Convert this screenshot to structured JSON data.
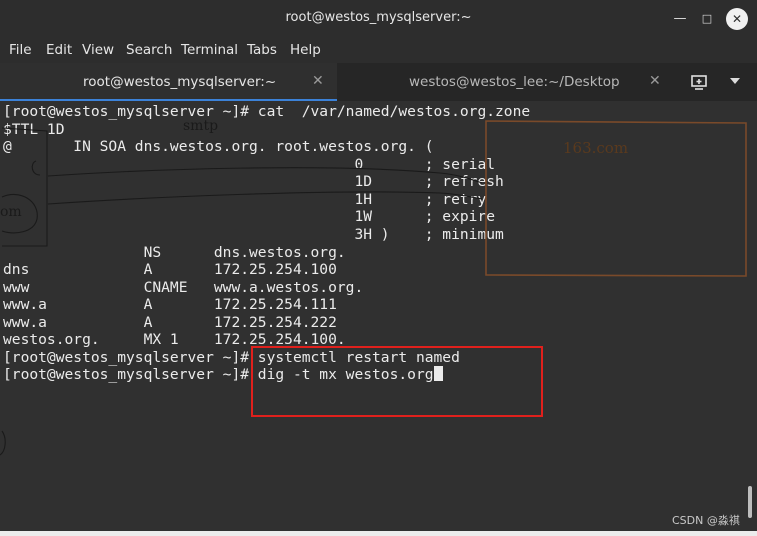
{
  "window": {
    "title": "root@westos_mysqlserver:~"
  },
  "menu": [
    "File",
    "Edit",
    "View",
    "Search",
    "Terminal",
    "Tabs",
    "Help"
  ],
  "tabs": [
    {
      "label": "root@westos_mysqlserver:~",
      "active": true
    },
    {
      "label": "westos@westos_lee:~/Desktop",
      "active": false
    }
  ],
  "terminal": {
    "lines": [
      "[root@westos_mysqlserver ~]# cat  /var/named/westos.org.zone",
      "$TTL 1D",
      "@       IN SOA dns.westos.org. root.westos.org. (",
      "                                        0       ; serial",
      "                                        1D      ; refresh",
      "                                        1H      ; retry",
      "                                        1W      ; expire",
      "                                        3H )    ; minimum",
      "                NS      dns.westos.org.",
      "dns             A       172.25.254.100",
      "www             CNAME   www.a.westos.org.",
      "www.a           A       172.25.254.111",
      "www.a           A       172.25.254.222",
      "westos.org.     MX 1    172.25.254.100.",
      "[root@westos_mysqlserver ~]# systemctl restart named",
      "[root@westos_mysqlserver ~]# dig -t mx westos.org"
    ]
  },
  "annotations": {
    "smtp": "smtp",
    "mail_host": "163.com",
    "partial_label": "om"
  },
  "watermark": "CSDN @淼祺",
  "colors": {
    "terminal_bg": "#303030",
    "text": "#ebebeb",
    "highlight_box": "#e0201c",
    "sketch_box": "#7a4a2a",
    "active_tab_accent": "#3c82d8"
  }
}
